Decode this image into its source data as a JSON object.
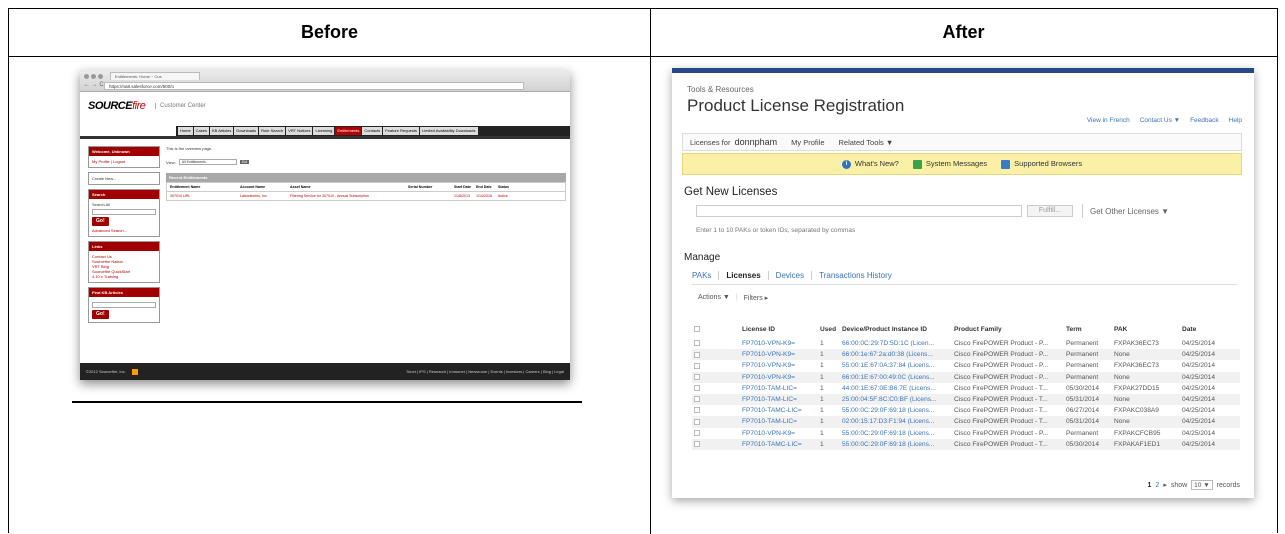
{
  "headers": {
    "before": "Before",
    "after": "After"
  },
  "before": {
    "tab_title": "Entitlements: Home ~ Cus",
    "url": "https://na8.salesforce.com/500/o",
    "logo_main": "SOURCE",
    "logo_accent": "fire",
    "logo_sub": "Customer Center",
    "menu": [
      "Home",
      "Cases",
      "KB Articles",
      "Downloads",
      "Rule Search",
      "VRT Notices",
      "Licensing",
      "Entitlements",
      "Contacts",
      "Feature Requests",
      "Limited Availability Downloads"
    ],
    "menu_active": "Entitlements",
    "welcome_title": "Welcome, Unknown",
    "profile_links": "My Profile | Logout",
    "create_new": "Create New...",
    "search_title": "Search",
    "search_all": "Search All",
    "go": "Go!",
    "advanced_search": "Advanced Search...",
    "links_title": "Links",
    "links": [
      "Contact Us",
      "Sourcefire Nation",
      "VRT Blog",
      "Sourcefire QuickStart",
      "4.10.x Training"
    ],
    "find_kb_title": "Find KB Articles",
    "overview_text": "This is the overview page.",
    "view_label": "View:",
    "view_select": "All Entitlements",
    "view_go": "Go!",
    "recent_title": "Recent Entitlements",
    "columns": [
      "Entitlement Name",
      "Account Name",
      "Asset Name",
      "Serial Number",
      "Start Date",
      "End Date",
      "Status"
    ],
    "row": [
      "307010 URL",
      "Laboratories, Inc.",
      "Filtering Service for 307010 - Annual Subscription",
      "",
      "1/18/2013",
      "1/14/2016",
      "Active"
    ],
    "footer_left": "©2012 Sourcefire, Inc.",
    "footer_right": "Snort | IPS | Research | Immunet | Newsroom | Events | Investors | Careers | Blog | Legal"
  },
  "after": {
    "breadcrumb": "Tools & Resources",
    "title": "Product License Registration",
    "top_links": [
      "View in French",
      "Contact Us ▼",
      "Feedback",
      "Help"
    ],
    "licenses_for_label": "Licenses for",
    "username": "donnpham",
    "my_profile": "My Profile",
    "related_tools": "Related Tools ▼",
    "notices": [
      "What's New?",
      "System Messages",
      "Supported Browsers"
    ],
    "get_new_title": "Get New Licenses",
    "fulfill_button": "Fulfill...",
    "get_other": "Get Other Licenses ▼",
    "hint": "Enter 1 to 10 PAKs or token IDs, separated by commas",
    "manage_title": "Manage",
    "tabs": [
      "PAKs",
      "Licenses",
      "Devices",
      "Transactions History"
    ],
    "active_tab": "Licenses",
    "actions": "Actions ▼",
    "filters": "Filters ▸",
    "columns": [
      "License ID",
      "Used",
      "Device/Product Instance ID",
      "Product Family",
      "Term",
      "PAK",
      "Date"
    ],
    "rows": [
      [
        "FP7010-VPN-K9=",
        "1",
        "66:00:0C:29:7D:5D:1C (Licen...",
        "Cisco FirePOWER Product - P...",
        "Permanent",
        "FXPAK36EC73",
        "04/25/2014"
      ],
      [
        "FP7010-VPN-K9=",
        "1",
        "66:00:1e:67:2a:d0:38 (Licens...",
        "Cisco FirePOWER Product - P...",
        "Permanent",
        "None",
        "04/25/2014"
      ],
      [
        "FP7010-VPN-K9=",
        "1",
        "55:00:1E:67:0A:37:84 (Licens...",
        "Cisco FirePOWER Product - P...",
        "Permanent",
        "FXPAK36EC73",
        "04/25/2014"
      ],
      [
        "FP7010-VPN-K9=",
        "1",
        "66:00:1E:67:00:49:0C (Licens...",
        "Cisco FirePOWER Product - P...",
        "Permanent",
        "None",
        "04/25/2014"
      ],
      [
        "FP7010-TAM-LIC=",
        "1",
        "44:00:1E:67:0E:B6:7E (Licens...",
        "Cisco FirePOWER Product - T...",
        "05/30/2014",
        "FXPAK27DD15",
        "04/25/2014"
      ],
      [
        "FP7010-TAM-LIC=",
        "1",
        "25:00:04:5F:8C:C0:BF (Licens...",
        "Cisco FirePOWER Product - T...",
        "05/31/2014",
        "None",
        "04/25/2014"
      ],
      [
        "FP7010-TAMC-LIC=",
        "1",
        "55:00:0C:29:0F:69:18 (Licens...",
        "Cisco FirePOWER Product - T...",
        "06/27/2014",
        "FXPAKC038A9",
        "04/25/2014"
      ],
      [
        "FP7010-TAM-LIC=",
        "1",
        "02:00:15:17:D3:F1:94 (Licens...",
        "Cisco FirePOWER Product - T...",
        "05/31/2014",
        "None",
        "04/25/2014"
      ],
      [
        "FP7010-VPN-K9=",
        "1",
        "55:00:0C:29:0F:69:18 (Licens...",
        "Cisco FirePOWER Product - P...",
        "Permanent",
        "FXPAKCFCB95",
        "04/25/2014"
      ],
      [
        "FP7010-TAMC-LIC=",
        "1",
        "55:00:0C:29:0F:69:18 (Licens...",
        "Cisco FirePOWER Product - T...",
        "05/30/2014",
        "FXPAKAF1ED1",
        "04/25/2014"
      ]
    ],
    "pager_pages": [
      "1",
      "2"
    ],
    "pager_next": "▸",
    "pager_show": "show",
    "pager_select": "10 ▼",
    "pager_records": "records"
  }
}
